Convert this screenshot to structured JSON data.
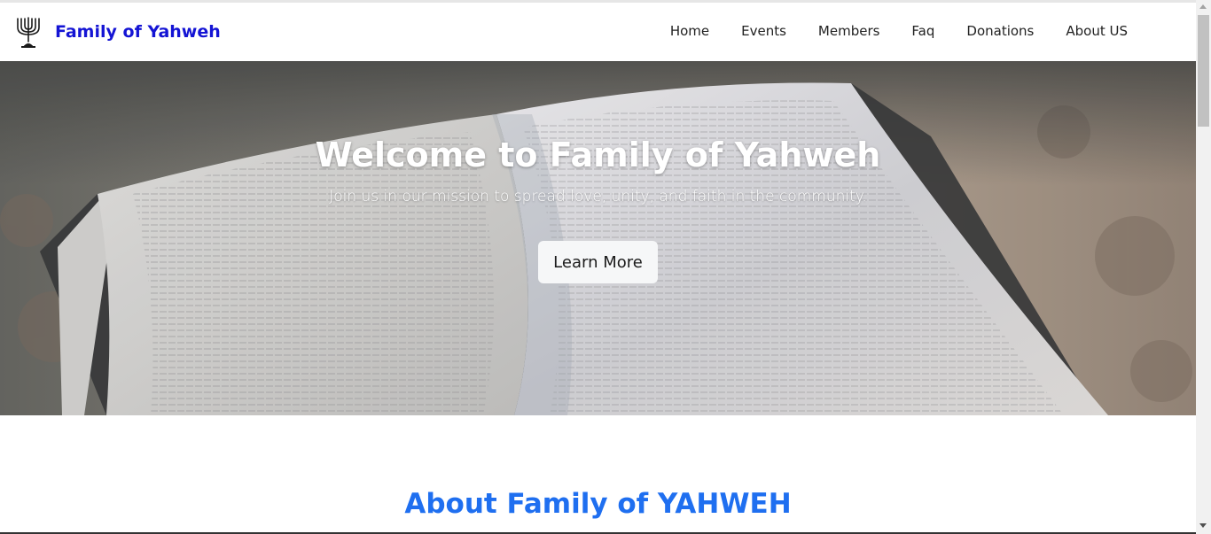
{
  "navbar": {
    "brand": {
      "title": "Family of Yahweh",
      "logo_icon": "menorah-icon"
    },
    "links": [
      {
        "label": "Home"
      },
      {
        "label": "Events"
      },
      {
        "label": "Members"
      },
      {
        "label": "Faq"
      },
      {
        "label": "Donations"
      },
      {
        "label": "About US"
      }
    ]
  },
  "hero": {
    "title": "Welcome to Family of Yahweh",
    "subtitle": "Join us in our mission to spread love, unity, and faith in the community.",
    "button_label": "Learn More",
    "background": "open-bible-photo"
  },
  "about": {
    "heading": "About Family of YAHWEH"
  },
  "colors": {
    "brand": "#1414d4",
    "accent": "#1f6ff0",
    "button_bg": "#f6f7f8"
  }
}
